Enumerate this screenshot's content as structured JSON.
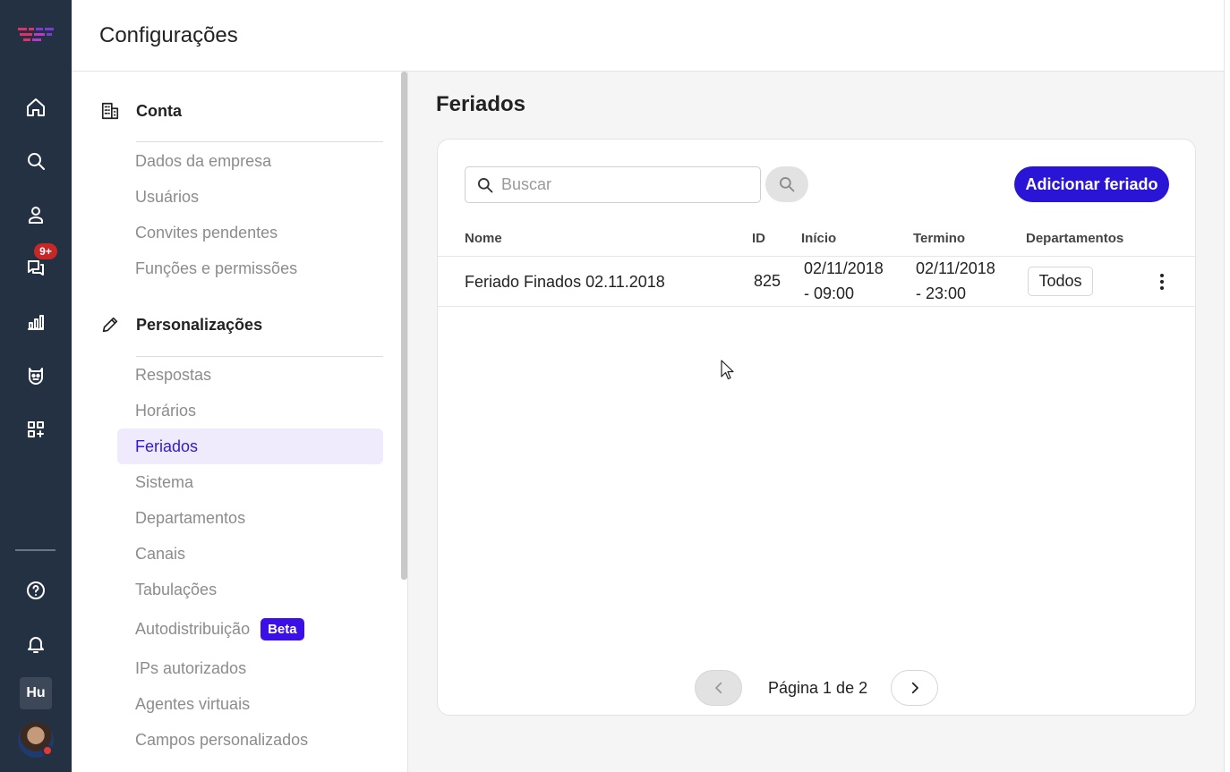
{
  "app": {
    "title": "Configurações"
  },
  "rail": {
    "items": [
      "home-icon",
      "search-icon",
      "user-icon",
      "chat-icon",
      "reports-icon",
      "bot-icon",
      "apps-icon"
    ],
    "chat_badge": "9+",
    "help": "help-icon",
    "notifications": "bell-icon",
    "workspace_label": "Hu"
  },
  "sidebar": {
    "conta": {
      "title": "Conta",
      "items": [
        "Dados da empresa",
        "Usuários",
        "Convites pendentes",
        "Funções e permissões"
      ]
    },
    "personalizacoes": {
      "title": "Personalizações",
      "items": [
        "Respostas",
        "Horários",
        "Feriados",
        "Sistema",
        "Departamentos",
        "Canais",
        "Tabulações",
        "Autodistribuição",
        "IPs autorizados",
        "Agentes virtuais",
        "Campos personalizados"
      ],
      "active": "Feriados",
      "beta_label": "Beta"
    }
  },
  "main": {
    "title": "Feriados",
    "search": {
      "placeholder": "Buscar",
      "value": ""
    },
    "add_button": "Adicionar feriado",
    "table": {
      "columns": [
        "Nome",
        "ID",
        "Início",
        "Termino",
        "Departamentos"
      ],
      "rows": [
        {
          "nome": "Feriado Finados 02.11.2018",
          "id": "825",
          "inicio_date": "02/11/2018",
          "inicio_time": "- 09:00",
          "termino_date": "02/11/2018",
          "termino_time": "- 23:00",
          "departamentos": "Todos"
        }
      ]
    },
    "pagination": {
      "text": "Página 1 de 2",
      "current": 1,
      "total": 2
    }
  },
  "colors": {
    "rail": "#243142",
    "accent": "#2a14d6",
    "active_bg": "#efebfd",
    "badge": "#c62828"
  }
}
